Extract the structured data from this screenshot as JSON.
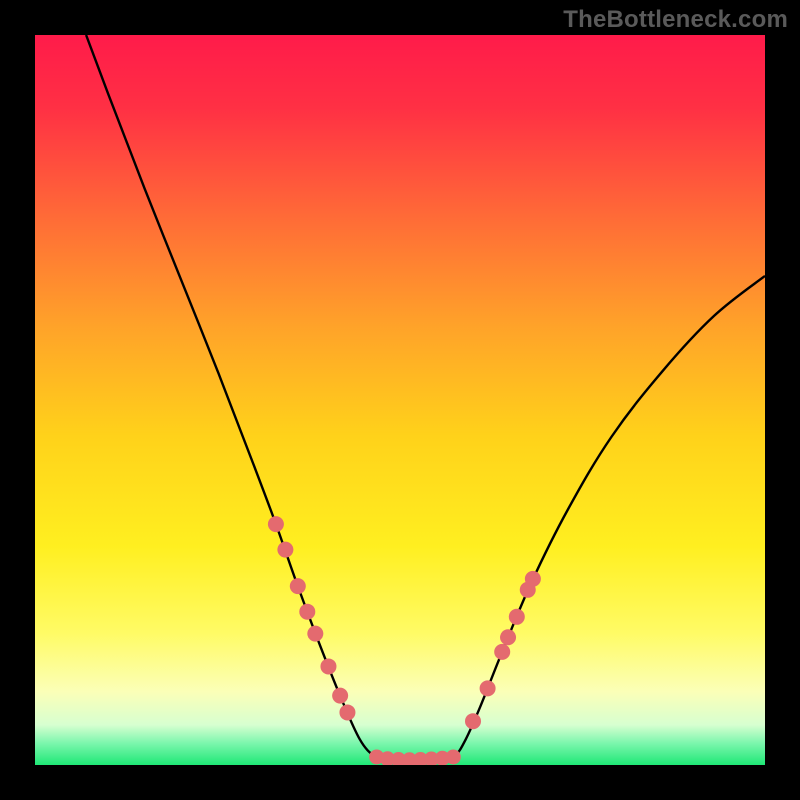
{
  "watermark": "TheBottleneck.com",
  "colors": {
    "black": "#000000",
    "curve": "#000000",
    "dot_fill": "#e46a6f",
    "dot_stroke": "#c84a50",
    "green": "#1fe876"
  },
  "chart_data": {
    "type": "line",
    "title": "",
    "xlabel": "",
    "ylabel": "",
    "xlim": [
      0,
      100
    ],
    "ylim": [
      0,
      100
    ],
    "background_gradient": {
      "stops": [
        {
          "pos": 0.0,
          "color": "#ff1b4a"
        },
        {
          "pos": 0.1,
          "color": "#ff3044"
        },
        {
          "pos": 0.25,
          "color": "#ff6b37"
        },
        {
          "pos": 0.4,
          "color": "#ffa329"
        },
        {
          "pos": 0.55,
          "color": "#ffd21a"
        },
        {
          "pos": 0.7,
          "color": "#ffef20"
        },
        {
          "pos": 0.82,
          "color": "#fffb66"
        },
        {
          "pos": 0.9,
          "color": "#fbffb8"
        },
        {
          "pos": 0.945,
          "color": "#d7ffd0"
        },
        {
          "pos": 0.97,
          "color": "#7cf6ad"
        },
        {
          "pos": 1.0,
          "color": "#1fe876"
        }
      ]
    },
    "series": [
      {
        "name": "curve-left",
        "x": [
          7,
          10,
          15,
          20,
          25,
          30,
          33,
          36,
          39,
          42,
          44.5,
          46.5
        ],
        "y": [
          100,
          92,
          79,
          66.5,
          54,
          41,
          33,
          24.5,
          16.5,
          9,
          3.5,
          1.2
        ]
      },
      {
        "name": "valley-floor",
        "x": [
          46.5,
          48,
          50,
          52,
          54,
          56,
          57.5
        ],
        "y": [
          1.2,
          0.8,
          0.7,
          0.7,
          0.8,
          0.9,
          1.2
        ]
      },
      {
        "name": "curve-right",
        "x": [
          57.5,
          59,
          61,
          64,
          68,
          73,
          79,
          86,
          93,
          100
        ],
        "y": [
          1.2,
          3.5,
          8,
          15.5,
          25,
          35,
          45,
          54,
          61.5,
          67
        ]
      }
    ],
    "dots_cluster": [
      {
        "x": 33.0,
        "y": 33.0
      },
      {
        "x": 34.3,
        "y": 29.5
      },
      {
        "x": 36.0,
        "y": 24.5
      },
      {
        "x": 37.3,
        "y": 21.0
      },
      {
        "x": 38.4,
        "y": 18.0
      },
      {
        "x": 40.2,
        "y": 13.5
      },
      {
        "x": 41.8,
        "y": 9.5
      },
      {
        "x": 42.8,
        "y": 7.2
      },
      {
        "x": 60.0,
        "y": 6.0
      },
      {
        "x": 62.0,
        "y": 10.5
      },
      {
        "x": 64.0,
        "y": 15.5
      },
      {
        "x": 64.8,
        "y": 17.5
      },
      {
        "x": 66.0,
        "y": 20.3
      },
      {
        "x": 67.5,
        "y": 24.0
      },
      {
        "x": 68.2,
        "y": 25.5
      }
    ],
    "dots_floor": [
      {
        "x": 46.8,
        "y": 1.1
      },
      {
        "x": 48.3,
        "y": 0.85
      },
      {
        "x": 49.8,
        "y": 0.75
      },
      {
        "x": 51.3,
        "y": 0.72
      },
      {
        "x": 52.8,
        "y": 0.75
      },
      {
        "x": 54.3,
        "y": 0.82
      },
      {
        "x": 55.8,
        "y": 0.92
      },
      {
        "x": 57.3,
        "y": 1.1
      }
    ]
  }
}
